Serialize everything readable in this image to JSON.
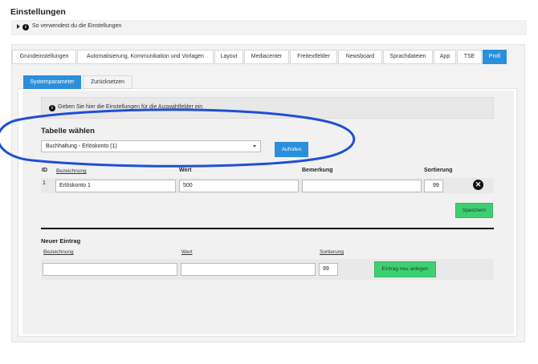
{
  "page": {
    "title": "Einstellungen",
    "info": "So verwendest du die Einstellungen"
  },
  "tabs": [
    {
      "label": "Grundeinstellungen",
      "active": false
    },
    {
      "label": "Automatisierung, Kommunikation und Vorlagen",
      "active": false
    },
    {
      "label": "Layout",
      "active": false
    },
    {
      "label": "Mediacenter",
      "active": false
    },
    {
      "label": "Freitextfelder",
      "active": false
    },
    {
      "label": "Newsboard",
      "active": false
    },
    {
      "label": "Sprachdateien",
      "active": false
    },
    {
      "label": "App",
      "active": false
    },
    {
      "label": "TSE",
      "active": false
    },
    {
      "label": "Profi",
      "active": true
    }
  ],
  "subtabs": [
    {
      "label": "Systemparameter",
      "active": true
    },
    {
      "label": "Zurücksetzen",
      "active": false
    }
  ],
  "note": "Geben Sie hier die Einstellungen für die Auswahlfelder ein",
  "table_select": {
    "heading": "Tabelle wählen",
    "selected": "Buchhaltung - Erlöskonto (1)",
    "button": "Aufrufen"
  },
  "entries": {
    "headers": {
      "id": "ID",
      "bezeichnung": "Bezeichnung",
      "wert": "Wert",
      "bemerkung": "Bemerkung",
      "sortierung": "Sortierung"
    },
    "rows": [
      {
        "id": "1",
        "bezeichnung": "Erlöskonto 1",
        "wert": "500",
        "bemerkung": "",
        "sortierung": "99"
      }
    ],
    "save_button": "Speichern"
  },
  "new_entry": {
    "heading": "Neuer Eintrag",
    "headers": {
      "bezeichnung": "Bezeichnung",
      "wert": "Wert",
      "sortierung": "Sortierung"
    },
    "bezeichnung": "",
    "wert": "",
    "sortierung": "99",
    "button": "Eintrag neu anlegen"
  },
  "colors": {
    "accent": "#2b8fdc",
    "green": "#3fcf73",
    "annotation": "#1f4fd6"
  }
}
